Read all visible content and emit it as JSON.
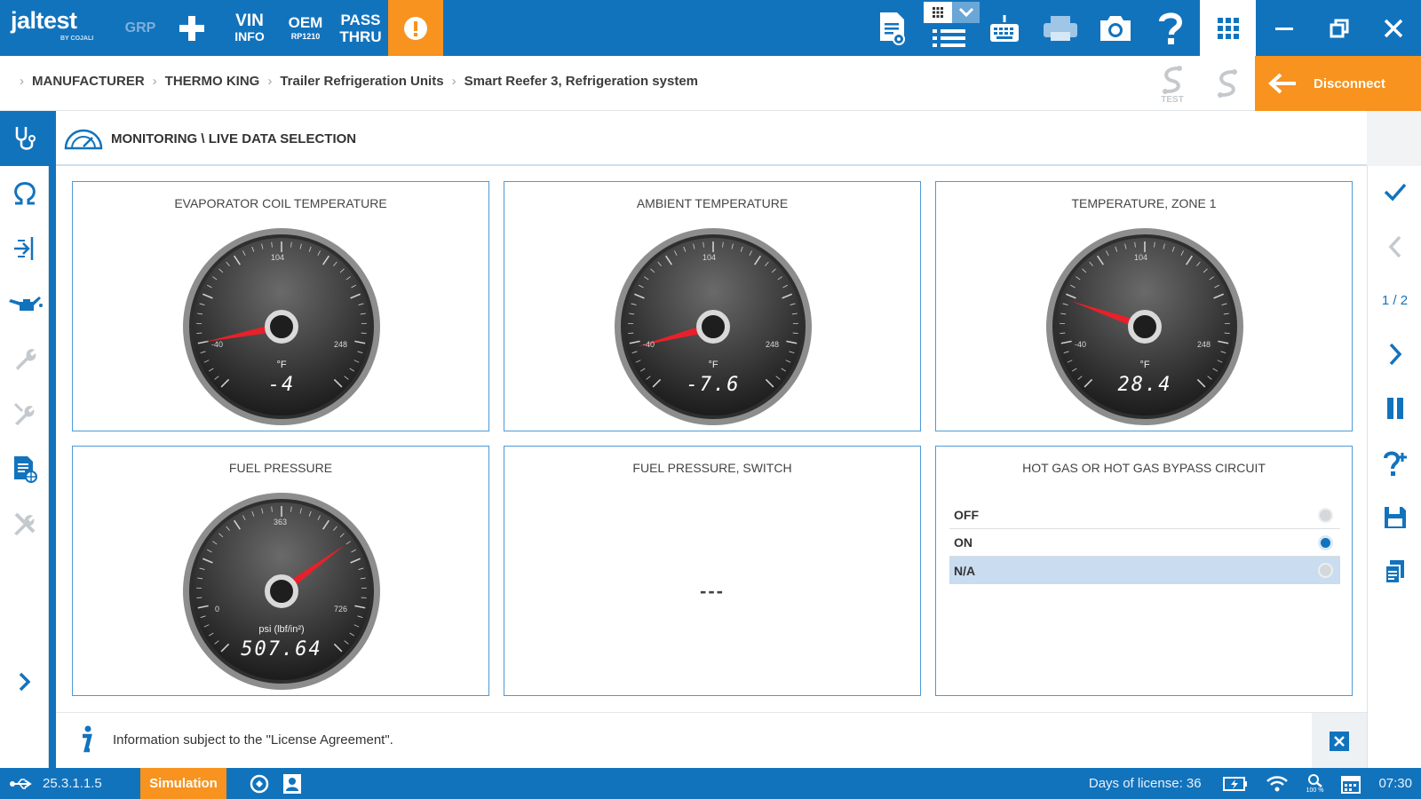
{
  "app": {
    "logo_text": "jaltest",
    "logo_sub": "BY COJALI",
    "grp_label": "GRP",
    "vin_line1": "VIN",
    "vin_line2": "INFO",
    "oem_line1": "OEM",
    "oem_line2": "RP1210",
    "pass_line1": "PASS",
    "pass_line2": "THRU"
  },
  "breadcrumb": {
    "items": [
      "MANUFACTURER",
      "THERMO KING",
      "Trailer Refrigeration Units",
      "Smart Reefer 3, Refrigeration system"
    ]
  },
  "header_actions": {
    "test_label": "TEST",
    "disconnect_label": "Disconnect"
  },
  "main": {
    "title": "MONITORING \\ LIVE DATA SELECTION"
  },
  "panels": [
    {
      "title": "EVAPORATOR COIL TEMPERATURE",
      "type": "gauge",
      "min": -40,
      "mid": 104,
      "max": 248,
      "unit": "°F",
      "value": -4,
      "value_text": "-4"
    },
    {
      "title": "AMBIENT TEMPERATURE",
      "type": "gauge",
      "min": -40,
      "mid": 104,
      "max": 248,
      "unit": "°F",
      "value": -7.6,
      "value_text": "-7.6"
    },
    {
      "title": "TEMPERATURE, ZONE 1",
      "type": "gauge",
      "min": -40,
      "mid": 104,
      "max": 248,
      "unit": "°F",
      "value": 28.4,
      "value_text": "28.4"
    },
    {
      "title": "FUEL PRESSURE",
      "type": "gauge",
      "min": 0,
      "mid": 363,
      "max": 726,
      "unit": "psi (lbf/in²)",
      "value": 507.64,
      "value_text": "507.64"
    },
    {
      "title": "FUEL PRESSURE, SWITCH",
      "type": "value",
      "value_text": "---"
    },
    {
      "title": "HOT GAS OR HOT GAS BYPASS CIRCUIT",
      "type": "options",
      "options": [
        "OFF",
        "ON",
        "N/A"
      ],
      "active": "ON",
      "highlighted": "N/A"
    }
  ],
  "right_sidebar": {
    "page": "1 / 2"
  },
  "info": {
    "text": "Information subject to the \"License Agreement\"."
  },
  "status": {
    "version": "25.3.1.1.5",
    "mode": "Simulation",
    "license": "Days of license: 36",
    "zoom": "100 %",
    "time": "07:30"
  },
  "colors": {
    "primary": "#1273bd",
    "accent": "#f7931e",
    "needle": "#e8202a"
  }
}
